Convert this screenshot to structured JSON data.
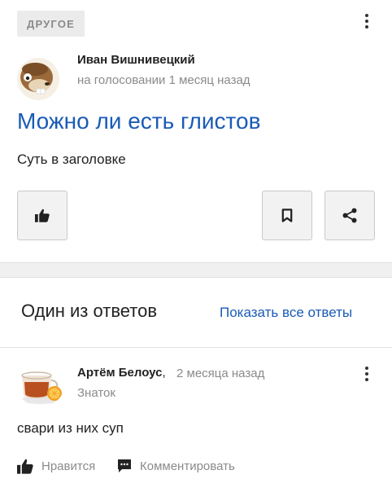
{
  "question": {
    "category": "ДРУГОЕ",
    "author": "Иван Вишнивецкий",
    "meta": "на голосовании 1 месяц назад",
    "title": "Можно ли есть глистов",
    "body": "Суть в заголовке",
    "actions": {
      "like_icon": "thumbs-up-icon",
      "bookmark_icon": "bookmark-icon",
      "share_icon": "share-icon",
      "menu_icon": "more-vertical-icon"
    }
  },
  "answers": {
    "heading": "Один из ответов",
    "show_all_label": "Показать все ответы",
    "item": {
      "author": "Артём Белоус",
      "separator": ",",
      "time": "2 месяца назад",
      "rank": "Знаток",
      "text": "свари из них суп",
      "like_label": "Нравится",
      "comment_label": "Комментировать"
    }
  },
  "colors": {
    "link_blue": "#1a5bb5",
    "muted_gray": "#8a8a8a",
    "badge_bg": "#ebebeb",
    "button_bg": "#f2f2f2"
  }
}
